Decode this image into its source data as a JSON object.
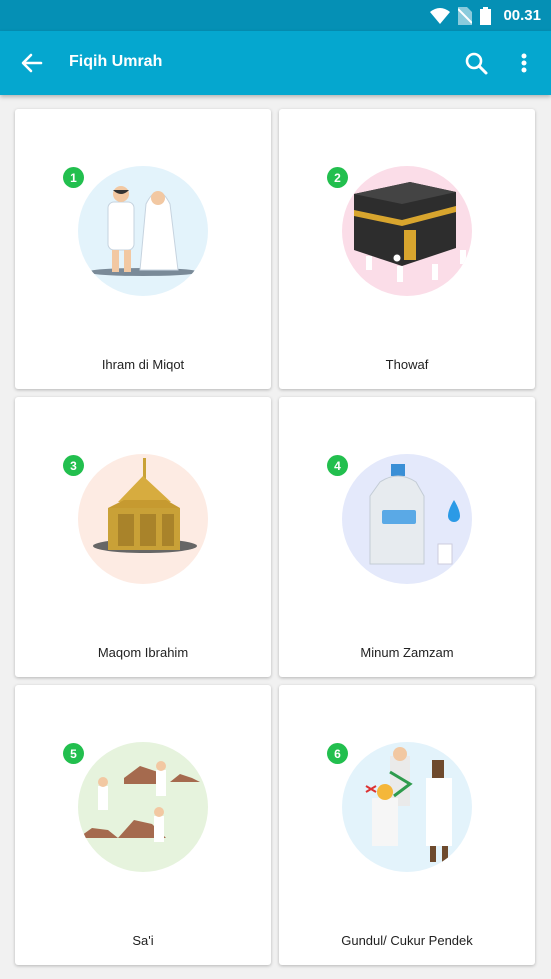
{
  "status_bar": {
    "time": "00.31",
    "icons": [
      "wifi-icon",
      "no-sim-icon",
      "battery-icon"
    ]
  },
  "app_bar": {
    "title": "Fiqih Umrah",
    "back_icon": "arrow-left-icon",
    "search_icon": "search-icon",
    "more_icon": "more-vert-icon"
  },
  "colors": {
    "app_bar": "#05a7cf",
    "status_bar": "#0590b5",
    "badge": "#22bf4e",
    "background": "#f1f1f1"
  },
  "cards": [
    {
      "number": "1",
      "label": "Ihram di Miqot",
      "circle_color": "#e3f3fb"
    },
    {
      "number": "2",
      "label": "Thowaf",
      "circle_color": "#fbdde8"
    },
    {
      "number": "3",
      "label": "Maqom Ibrahim",
      "circle_color": "#fdebe3"
    },
    {
      "number": "4",
      "label": "Minum Zamzam",
      "circle_color": "#e4e9fb"
    },
    {
      "number": "5",
      "label": "Sa'i",
      "circle_color": "#e6f3dd"
    },
    {
      "number": "6",
      "label": "Gundul/ Cukur Pendek",
      "circle_color": "#e3f3fb"
    }
  ]
}
